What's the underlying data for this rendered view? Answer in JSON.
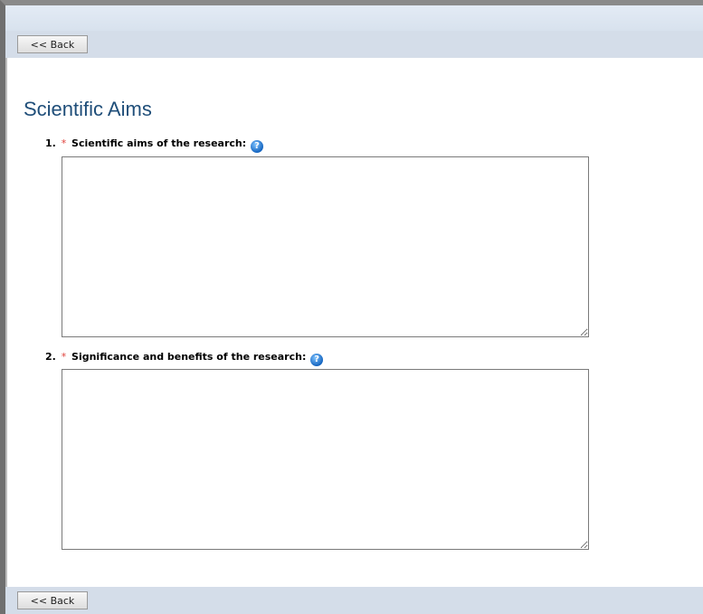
{
  "nav": {
    "back_label": "<< Back"
  },
  "page": {
    "title": "Scientific Aims"
  },
  "questions": [
    {
      "number": "1.",
      "required_marker": "*",
      "label": "Scientific aims of the research:",
      "value": ""
    },
    {
      "number": "2.",
      "required_marker": "*",
      "label": "Significance and benefits of the research:",
      "value": ""
    }
  ],
  "icons": {
    "help": "help-icon",
    "help_glyph": "?"
  },
  "colors": {
    "title": "#1f4e79",
    "required": "#e0403a",
    "nav_bar": "#d4dde9",
    "help_icon": "#1565c0"
  }
}
